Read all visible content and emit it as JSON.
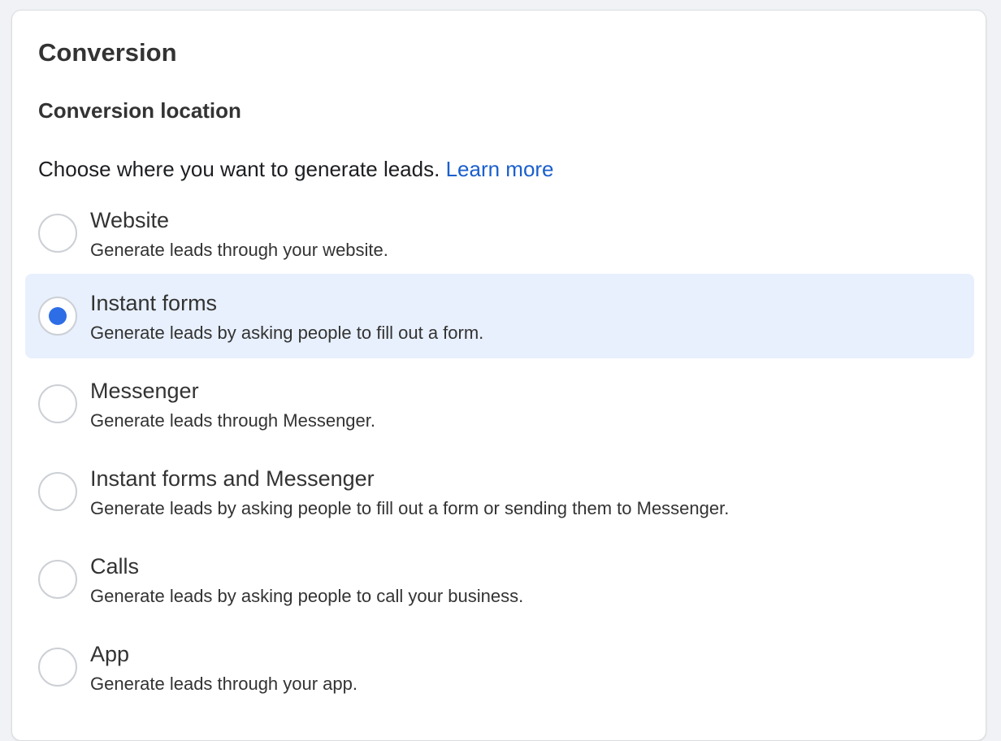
{
  "section": {
    "title": "Conversion"
  },
  "conversion_location": {
    "title": "Conversion location",
    "description": "Choose where you want to generate leads.",
    "learn_more": "Learn more"
  },
  "options": [
    {
      "label": "Website",
      "description": "Generate leads through your website.",
      "selected": false
    },
    {
      "label": "Instant forms",
      "description": "Generate leads by asking people to fill out a form.",
      "selected": true
    },
    {
      "label": "Messenger",
      "description": "Generate leads through Messenger.",
      "selected": false
    },
    {
      "label": "Instant forms and Messenger",
      "description": "Generate leads by asking people to fill out a form or sending them to Messenger.",
      "selected": false
    },
    {
      "label": "Calls",
      "description": "Generate leads by asking people to call your business.",
      "selected": false
    },
    {
      "label": "App",
      "description": "Generate leads through your app.",
      "selected": false
    }
  ],
  "colors": {
    "accent": "#2d6ee6",
    "link": "#1a5fcc",
    "selected_background": "#e8f0fd"
  }
}
